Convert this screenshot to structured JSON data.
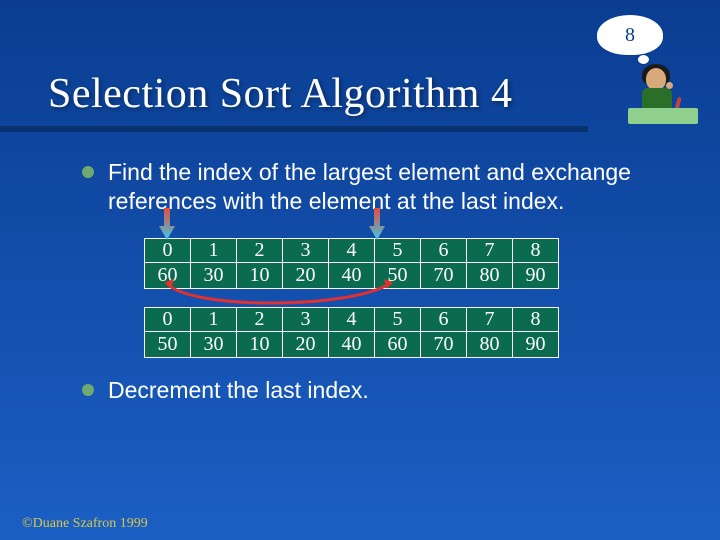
{
  "slide_number": "8",
  "title": "Selection Sort Algorithm 4",
  "bullets": [
    "Find the index of the largest element and exchange references with the element at the last index.",
    "Decrement the last index."
  ],
  "chart_data": {
    "type": "table",
    "tables": [
      {
        "indices": [
          "0",
          "1",
          "2",
          "3",
          "4",
          "5",
          "6",
          "7",
          "8"
        ],
        "values": [
          "60",
          "30",
          "10",
          "20",
          "40",
          "50",
          "70",
          "80",
          "90"
        ],
        "arrows_at_index": [
          0,
          5
        ],
        "swap_between": [
          0,
          5
        ]
      },
      {
        "indices": [
          "0",
          "1",
          "2",
          "3",
          "4",
          "5",
          "6",
          "7",
          "8"
        ],
        "values": [
          "50",
          "30",
          "10",
          "20",
          "40",
          "60",
          "70",
          "80",
          "90"
        ]
      }
    ]
  },
  "footer": "©Duane Szafron 1999"
}
